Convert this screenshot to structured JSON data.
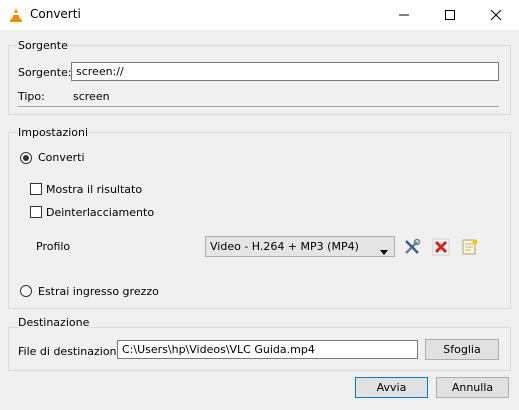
{
  "window": {
    "title": "Converti"
  },
  "source_group": {
    "title": "Sorgente",
    "source_label": "Sorgente:",
    "source_value": "screen://",
    "type_label": "Tipo:",
    "type_value": "screen"
  },
  "settings_group": {
    "title": "Impostazioni",
    "convert_label": "Converti",
    "convert_selected": true,
    "show_output_label": "Mostra il risultato",
    "show_output_checked": false,
    "deinterlace_label": "Deinterlacciamento",
    "deinterlace_checked": false,
    "profile_label": "Profilo",
    "profile_value": "Video - H.264 + MP3 (MP4)",
    "raw_dump_label": "Estrai ingresso grezzo",
    "raw_dump_selected": false,
    "icons": [
      "wrench-screwdriver-icon",
      "delete-red-x-icon",
      "new-profile-icon"
    ]
  },
  "destination_group": {
    "title": "Destinazione",
    "file_label": "File di destinazione:",
    "file_value": "C:\\Users\\hp\\Videos\\VLC Guida.mp4",
    "browse_label": "Sfoglia"
  },
  "buttons": {
    "start": "Avvia",
    "cancel": "Annulla"
  },
  "colors": {
    "vlc_orange": "#f48b00",
    "delete_red": "#d62020",
    "focus_blue": "#0078d7"
  }
}
